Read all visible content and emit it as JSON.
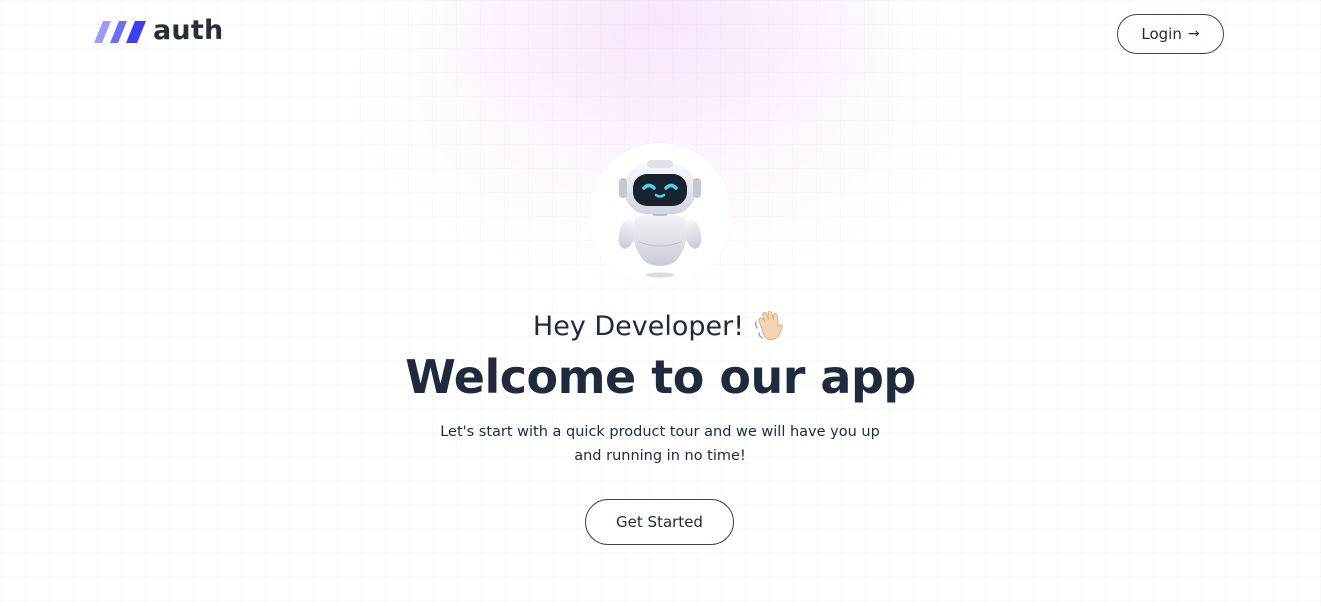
{
  "header": {
    "brand_name": "auth",
    "login_label": "Login",
    "login_icon": "arrow-right-icon",
    "brand_colors": [
      "#8b8ef5",
      "#5b5ff0",
      "#3d3ff0"
    ]
  },
  "hero": {
    "avatar_icon": "robot-icon",
    "greeting": "Hey Developer!",
    "greeting_icon": "waving-hand-icon",
    "headline": "Welcome to our app",
    "description": "Let's start with a quick product tour and we will have you up and running in no time!",
    "cta_label": "Get Started"
  },
  "colors": {
    "text": "#1f2a3c",
    "glow": "#f4d6fa",
    "robot_eyes": "#46d3f2"
  }
}
